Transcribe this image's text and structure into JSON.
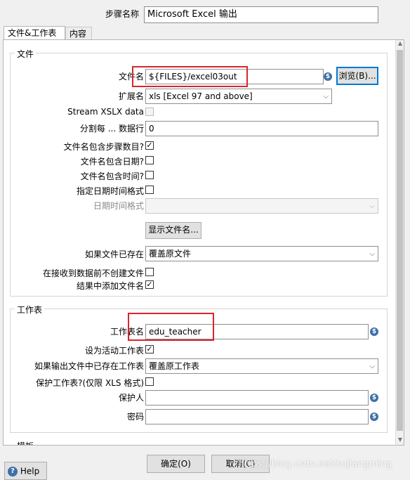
{
  "step_name": {
    "label": "步骤名称",
    "value": "Microsoft Excel 输出"
  },
  "tabs": [
    {
      "label": "文件&工作表"
    },
    {
      "label": "内容"
    }
  ],
  "file_group": {
    "title": "文件",
    "filename": {
      "label": "文件名",
      "value": "${FILES}/excel03out",
      "var_icon": "$"
    },
    "browse_button": "浏览(B)...",
    "extension": {
      "label": "扩展名",
      "value": "xls [Excel 97 and above]"
    },
    "stream_xslx": {
      "label": "Stream XSLX data",
      "checked": false
    },
    "split_every": {
      "label": "分割每 ... 数据行",
      "value": "0"
    },
    "include_stepnr": {
      "label": "文件名包含步骤数目?",
      "checked": true
    },
    "include_date": {
      "label": "文件名包含日期?",
      "checked": false
    },
    "include_time": {
      "label": "文件名包含时间?",
      "checked": false
    },
    "specify_format": {
      "label": "指定日期时间格式",
      "checked": false
    },
    "date_format": {
      "label": "日期时间格式",
      "value": ""
    },
    "show_files_button": "显示文件名...",
    "if_exists": {
      "label": "如果文件已存在",
      "value": "覆盖原文件"
    },
    "no_create_empty": {
      "label": "在接收到数据前不创建文件",
      "checked": false
    },
    "add_to_result": {
      "label": "结果中添加文件名",
      "checked": true
    }
  },
  "sheet_group": {
    "title": "工作表",
    "sheet_name": {
      "label": "工作表名",
      "value": "edu_teacher"
    },
    "make_active": {
      "label": "设为活动工作表",
      "checked": true
    },
    "if_sheet_exists": {
      "label": "如果输出文件中已存在工作表",
      "value": "覆盖原工作表"
    },
    "protect_sheet": {
      "label": "保护工作表?(仅限 XLS 格式)",
      "checked": false
    },
    "protected_by": {
      "label": "保护人",
      "value": ""
    },
    "password": {
      "label": "密码",
      "value": ""
    }
  },
  "template_group": {
    "title": "模板"
  },
  "footer": {
    "help": "Help",
    "ok": "确定(O)",
    "cancel": "取消(C)",
    "watermark": "https://blog.csdn.net/sujiangming"
  },
  "icons": {
    "var": "dollar-variable-icon",
    "help": "help-question-icon"
  },
  "colors": {
    "highlight": "#d9252b",
    "browse_border": "#0078d7",
    "var_icon": "#3d6fa7"
  }
}
